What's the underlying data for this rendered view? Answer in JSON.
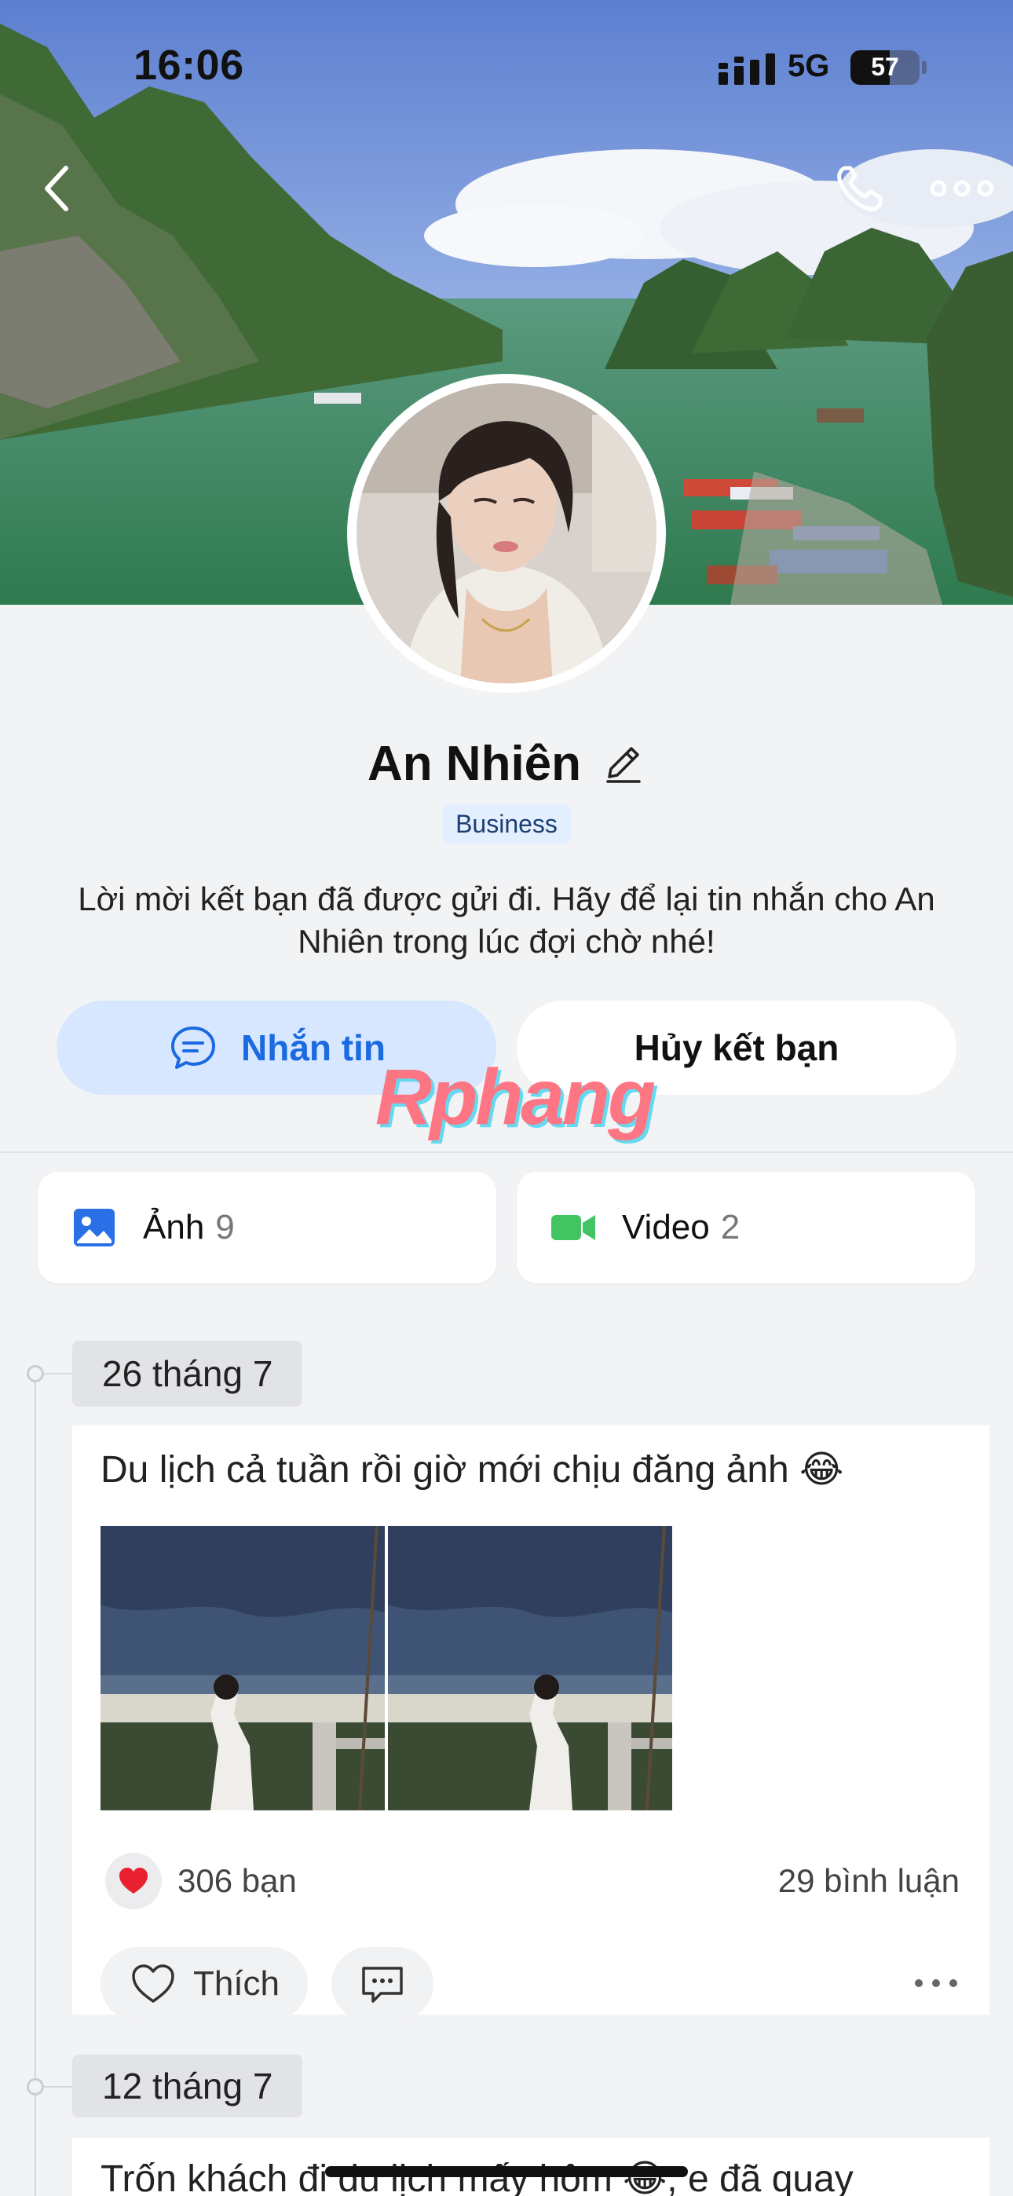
{
  "status_bar": {
    "time": "16:06",
    "network": "5G",
    "battery": "57",
    "battery_level": 0.57
  },
  "profile": {
    "name": "An Nhiên",
    "badge": "Business",
    "invite_message": "Lời mời kết bạn đã được gửi đi. Hãy để lại tin nhắn cho An Nhiên trong lúc đợi chờ nhé!"
  },
  "actions": {
    "message_label": "Nhắn tin",
    "unfriend_label": "Hủy kết bạn"
  },
  "watermark": "Rphang",
  "media": {
    "photos_label": "Ảnh",
    "photos_count": "9",
    "videos_label": "Video",
    "videos_count": "2"
  },
  "timeline": [
    {
      "date": "26 tháng 7",
      "text": "Du lịch cả tuần rồi giờ mới chịu đăng ảnh 😂",
      "reactions": "306 bạn",
      "comments": "29 bình luận",
      "like_label": "Thích"
    },
    {
      "date": "12 tháng 7",
      "text": "Trốn khách đi du lịch mấy hôm 😂, e đã quay"
    }
  ],
  "icons": {
    "back": "chevron-left-icon",
    "call": "phone-icon",
    "more": "more-dots-icon",
    "edit": "pencil-icon",
    "message": "chat-bubble-icon",
    "photos": "image-icon",
    "videos": "video-camera-icon",
    "heart": "heart-icon",
    "like": "heart-outline-icon",
    "comment": "comment-icon"
  },
  "colors": {
    "accent": "#1b6ae0",
    "accent_bg": "#d7e7ff",
    "video_green": "#43c462",
    "heart_red": "#e8202f"
  }
}
